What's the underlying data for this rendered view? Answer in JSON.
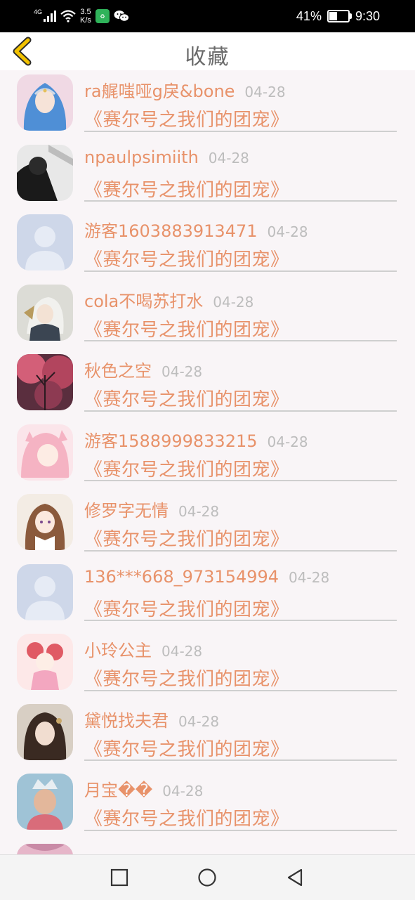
{
  "status_bar": {
    "signal_label": "4G",
    "speed_value": "3.5",
    "speed_unit": "K/s",
    "battery_percent": "41%",
    "battery_level": 0.41,
    "time": "9:30",
    "icons": [
      "signal-icon",
      "wifi-icon",
      "app-badge-icon",
      "wechat-icon",
      "battery-icon"
    ]
  },
  "header": {
    "title": "收藏",
    "back_icon": "chevron-left-icon",
    "accent_color": "#f2c200"
  },
  "colors": {
    "username": "#e8926a",
    "date": "#bdbdbd",
    "list_background": "#f9f5f7"
  },
  "items": [
    {
      "username": "ra艉嗤哑g戾&bone",
      "date": "04-28",
      "title": "《赛尔号之我们的团宠》",
      "avatar": "avatar-portrait-blue-veil"
    },
    {
      "username": "npaulpsimiith",
      "date": "04-28",
      "title": "《赛尔号之我们的团宠》",
      "avatar": "avatar-bw-figure"
    },
    {
      "username": "游客1603883913471",
      "date": "04-28",
      "title": "《赛尔号之我们的团宠》",
      "avatar": "avatar-default-silhouette"
    },
    {
      "username": "cola不喝苏打水",
      "date": "04-28",
      "title": "《赛尔号之我们的团宠》",
      "avatar": "avatar-anime-white-hair"
    },
    {
      "username": "秋色之空",
      "date": "04-28",
      "title": "《赛尔号之我们的团宠》",
      "avatar": "avatar-pink-trees"
    },
    {
      "username": "游客1588999833215",
      "date": "04-28",
      "title": "《赛尔号之我们的团宠》",
      "avatar": "avatar-anime-pink-hair"
    },
    {
      "username": "修罗字无情",
      "date": "04-28",
      "title": "《赛尔号之我们的团宠》",
      "avatar": "avatar-anime-brown-hair"
    },
    {
      "username": "136***668_973154994",
      "date": "04-28",
      "title": "《赛尔号之我们的团宠》",
      "avatar": "avatar-default-silhouette"
    },
    {
      "username": "小玲公主",
      "date": "04-28",
      "title": "《赛尔号之我们的团宠》",
      "avatar": "avatar-anime-red-twins"
    },
    {
      "username": "黛悦找夫君",
      "date": "04-28",
      "title": "《赛尔号之我们的团宠》",
      "avatar": "avatar-anime-dark-hair"
    },
    {
      "username": "月宝��",
      "date": "04-28",
      "title": "《赛尔号之我们的团宠》",
      "avatar": "avatar-photo-crown"
    },
    {
      "username": "",
      "date": "",
      "title": "",
      "avatar": "avatar-partial-pink"
    }
  ],
  "nav_bar": {
    "buttons": [
      "recent-apps-icon",
      "home-icon",
      "back-icon"
    ]
  }
}
